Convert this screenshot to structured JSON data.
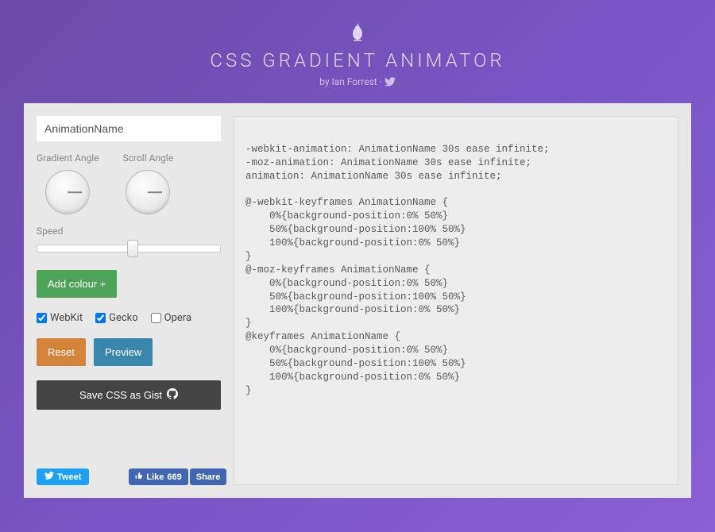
{
  "header": {
    "title": "CSS GRADIENT ANIMATOR",
    "byline_prefix": "by ",
    "author": "Ian Forrest",
    "byline_separator": " · "
  },
  "controls": {
    "name_placeholder": "AnimationName",
    "name_value": "AnimationName",
    "gradient_angle_label": "Gradient Angle",
    "scroll_angle_label": "Scroll Angle",
    "speed_label": "Speed",
    "add_colour_label": "Add colour +",
    "checks": {
      "webkit": {
        "label": "WebKit",
        "checked": true
      },
      "gecko": {
        "label": "Gecko",
        "checked": true
      },
      "opera": {
        "label": "Opera",
        "checked": false
      }
    },
    "reset_label": "Reset",
    "preview_label": "Preview",
    "save_label": "Save CSS as Gist"
  },
  "social": {
    "tweet_label": "Tweet",
    "fb_like_label": "Like",
    "fb_like_count": "669",
    "fb_share_label": "Share"
  },
  "code": "\n-webkit-animation: AnimationName 30s ease infinite;\n-moz-animation: AnimationName 30s ease infinite;\nanimation: AnimationName 30s ease infinite;\n\n@-webkit-keyframes AnimationName {\n    0%{background-position:0% 50%}\n    50%{background-position:100% 50%}\n    100%{background-position:0% 50%}\n}\n@-moz-keyframes AnimationName {\n    0%{background-position:0% 50%}\n    50%{background-position:100% 50%}\n    100%{background-position:0% 50%}\n}\n@keyframes AnimationName {\n    0%{background-position:0% 50%}\n    50%{background-position:100% 50%}\n    100%{background-position:0% 50%}\n}"
}
